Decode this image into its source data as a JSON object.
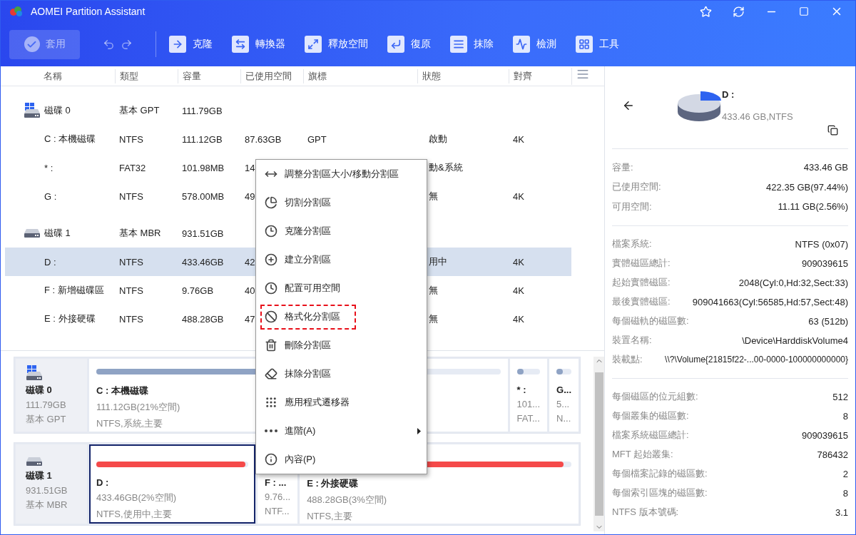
{
  "window": {
    "title": "AOMEI Partition Assistant"
  },
  "toolbar": {
    "apply": {
      "label": "套用",
      "disabled": true
    },
    "tools": [
      {
        "label": "克隆"
      },
      {
        "label": "轉換器"
      },
      {
        "label": "釋放空間"
      },
      {
        "label": "復原"
      },
      {
        "label": "抹除"
      },
      {
        "label": "檢測"
      },
      {
        "label": "工具"
      }
    ]
  },
  "table": {
    "columns": [
      "名稱",
      "類型",
      "容量",
      "已使用空間",
      "旗標",
      "狀態",
      "對齊"
    ],
    "rows": [
      {
        "kind": "disk",
        "system": true,
        "selected": false,
        "name": "磁碟 0",
        "type": "基本 GPT",
        "capacity": "111.79GB"
      },
      {
        "kind": "partition",
        "selected": false,
        "name": "C : 本機磁碟",
        "type": "NTFS",
        "capacity": "111.12GB",
        "used": "87.63GB",
        "flag": "GPT",
        "status": "啟動",
        "align": "4K"
      },
      {
        "kind": "partition",
        "selected": false,
        "name": "* :",
        "type": "FAT32",
        "capacity": "101.98MB",
        "used": "14",
        "status": "動&系統"
      },
      {
        "kind": "partition",
        "selected": false,
        "name": "G :",
        "type": "NTFS",
        "capacity": "578.00MB",
        "used": "49",
        "status": "無",
        "align": "4K"
      },
      {
        "kind": "disk",
        "system": false,
        "selected": false,
        "name": "磁碟 1",
        "type": "基本 MBR",
        "capacity": "931.51GB"
      },
      {
        "kind": "partition",
        "selected": true,
        "name": "D :",
        "type": "NTFS",
        "capacity": "433.46GB",
        "used": "42",
        "status": "用中",
        "align": "4K"
      },
      {
        "kind": "partition",
        "selected": false,
        "name": "F : 新增磁碟區",
        "type": "NTFS",
        "capacity": "9.76GB",
        "used": "40",
        "status": "無",
        "align": "4K"
      },
      {
        "kind": "partition",
        "selected": false,
        "name": "E : 外接硬碟",
        "type": "NTFS",
        "capacity": "488.28GB",
        "used": "47",
        "status": "無",
        "align": "4K"
      }
    ]
  },
  "context_menu": [
    {
      "label": "調整分割區大小/移動分割區",
      "highlighted": false,
      "submenu": false
    },
    {
      "label": "切割分割區",
      "highlighted": false,
      "submenu": false
    },
    {
      "label": "克隆分割區",
      "highlighted": false,
      "submenu": false
    },
    {
      "label": "建立分割區",
      "highlighted": false,
      "submenu": false
    },
    {
      "label": "配置可用空間",
      "highlighted": false,
      "submenu": false
    },
    {
      "label": "格式化分割區",
      "highlighted": true,
      "submenu": false
    },
    {
      "label": "刪除分割區",
      "highlighted": false,
      "submenu": false
    },
    {
      "label": "抹除分割區",
      "highlighted": false,
      "submenu": false
    },
    {
      "label": "應用程式遷移器",
      "highlighted": false,
      "submenu": false
    },
    {
      "label": "進階(A)",
      "highlighted": false,
      "submenu": true
    },
    {
      "label": "內容(P)",
      "highlighted": false,
      "submenu": false
    }
  ],
  "disk_map": [
    {
      "name": "磁碟 0",
      "size": "111.79GB",
      "type": "基本 GPT",
      "system": true,
      "partitions": [
        {
          "kind": "full",
          "selected": false,
          "name": "C : 本機磁碟",
          "size": "111.12GB(21%空間)",
          "info": "NTFS,系統,主要",
          "level": 0.79,
          "color": "#8fa3c4"
        },
        {
          "kind": "compact",
          "selected": false,
          "name": "* :",
          "size": "101...",
          "info": "FAT...",
          "level": 0.3,
          "color": "#8fa3c4"
        },
        {
          "kind": "compact",
          "selected": false,
          "name": "G...",
          "size": "5...",
          "info": "N...",
          "level": 0.45,
          "color": "#8fa3c4"
        }
      ]
    },
    {
      "name": "磁碟 1",
      "size": "931.51GB",
      "type": "基本 MBR",
      "system": false,
      "partitions": [
        {
          "kind": "medium",
          "selected": true,
          "name": "D :",
          "size": "433.46GB(2%空間)",
          "info": "NTFS,使用中,主要",
          "level": 0.98,
          "color": "#f54a4a"
        },
        {
          "kind": "compact",
          "selected": false,
          "name": "F : ...",
          "size": "9.76...",
          "info": "NTF..."
        },
        {
          "kind": "full",
          "selected": false,
          "name": "E : 外接硬碟",
          "size": "488.28GB(3%空間)",
          "info": "NTFS,主要",
          "level": 0.97,
          "color": "#f54a4a"
        }
      ]
    }
  ],
  "details": {
    "name": "D :",
    "summary": "433.46 GB,NTFS",
    "sections": [
      [
        {
          "label": "容量:",
          "value": "433.46 GB"
        },
        {
          "label": "已使用空間:",
          "value": "422.35 GB(97.44%)"
        },
        {
          "label": "可用空間:",
          "value": "11.11 GB(2.56%)"
        }
      ],
      [
        {
          "label": "檔案系統:",
          "value": "NTFS (0x07)"
        },
        {
          "label": "實體磁區總計:",
          "value": "909039615"
        },
        {
          "label": "起始實體磁區:",
          "value": "2048(Cyl:0,Hd:32,Sect:33)"
        },
        {
          "label": "最後實體磁區:",
          "value": "909041663(Cyl:56585,Hd:57,Sect:48)"
        },
        {
          "label": "每個磁軌的磁區數:",
          "value": "63 (512b)"
        },
        {
          "label": "裝置名稱:",
          "value": "\\Device\\HarddiskVolume4"
        },
        {
          "label": "裝載點:",
          "value": "\\\\?\\Volume{21815f22-...00-0000-100000000000}"
        }
      ],
      [
        {
          "label": "每個磁區的位元組數:",
          "value": "512"
        },
        {
          "label": "每個叢集的磁區數:",
          "value": "8"
        },
        {
          "label": "檔案系統磁區總計:",
          "value": "909039615"
        },
        {
          "label": "MFT 起始叢集:",
          "value": "786432"
        },
        {
          "label": "每個檔案記錄的磁區數:",
          "value": "2"
        },
        {
          "label": "每個索引區塊的磁區數:",
          "value": "8"
        },
        {
          "label": "NTFS 版本號碼:",
          "value": "3.1"
        }
      ]
    ]
  }
}
